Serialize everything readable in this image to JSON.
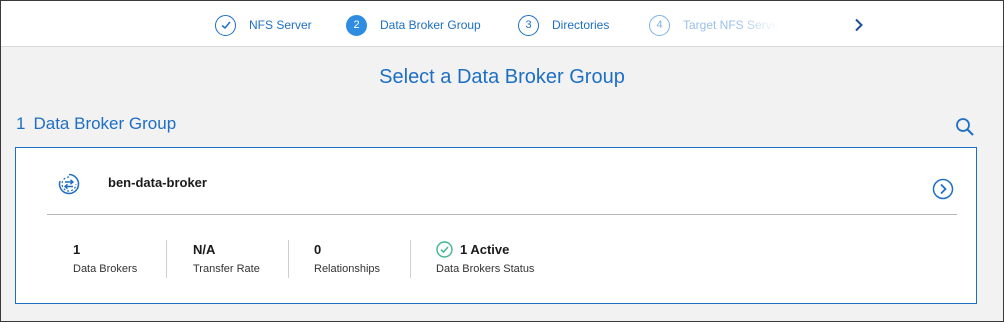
{
  "stepper": {
    "steps": [
      {
        "number": "1",
        "label": "NFS Server",
        "state": "done"
      },
      {
        "number": "2",
        "label": "Data Broker Group",
        "state": "active"
      },
      {
        "number": "3",
        "label": "Directories",
        "state": "pending"
      },
      {
        "number": "4",
        "label": "Target NFS Server",
        "state": "pending"
      }
    ],
    "next_icon": "chevron-right-icon"
  },
  "page": {
    "title": "Select a Data Broker Group",
    "group_count": "1",
    "group_count_label": "Data Broker Group",
    "search_icon": "search-icon"
  },
  "card": {
    "name": "ben-data-broker",
    "stats": {
      "brokers": {
        "value": "1",
        "caption": "Data Brokers"
      },
      "rate": {
        "value": "N/A",
        "caption": "Transfer Rate"
      },
      "relationships": {
        "value": "0",
        "caption": "Relationships"
      },
      "status": {
        "value": "1 Active",
        "caption": "Data Brokers Status",
        "color": "#3fb68b"
      }
    }
  },
  "colors": {
    "accent": "#1e6fc3",
    "active_step": "#2e8de0",
    "status_ok": "#3fb68b"
  }
}
